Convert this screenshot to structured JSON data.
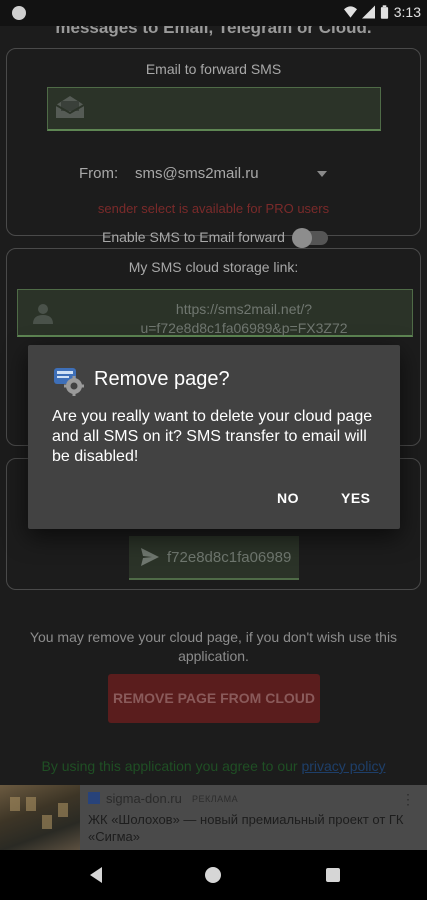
{
  "statusbar": {
    "time": "3:13"
  },
  "header": {
    "title": "messages to Email, Telegram or Cloud."
  },
  "email_card": {
    "label": "Email to forward SMS",
    "email_value": "",
    "from_label": "From:",
    "from_value": "sms@sms2mail.ru",
    "pro_note": "sender select is available for PRO users",
    "enable_label": "Enable SMS to Email forward",
    "enable_on": false
  },
  "cloud_card": {
    "label": "My SMS cloud storage link:",
    "link": "https://sms2mail.net/?u=f72e8d8c1fa06989&p=FX3Z72"
  },
  "telegram_card": {
    "code": "f72e8d8c1fa06989"
  },
  "remove": {
    "info": "You may remove your cloud page, if you don't wish use this application.",
    "button": "REMOVE PAGE FROM CLOUD"
  },
  "terms": {
    "text": "By using this application you agree to our ",
    "link": "privacy policy"
  },
  "ad": {
    "site": "sigma-don.ru",
    "tag": "РЕКЛАМА",
    "more": "⋮",
    "text": "ЖК «Шолохов» — новый премиальный проект от ГК «Сигма»"
  },
  "dialog": {
    "title": "Remove page?",
    "message": "Are you really want to delete your cloud page and all SMS on it? SMS transfer to email will be disabled!",
    "no": "NO",
    "yes": "YES"
  },
  "colors": {
    "accent_green": "#5e8653",
    "danger_red": "#5a1d1d",
    "dialog_bg": "#424242"
  }
}
